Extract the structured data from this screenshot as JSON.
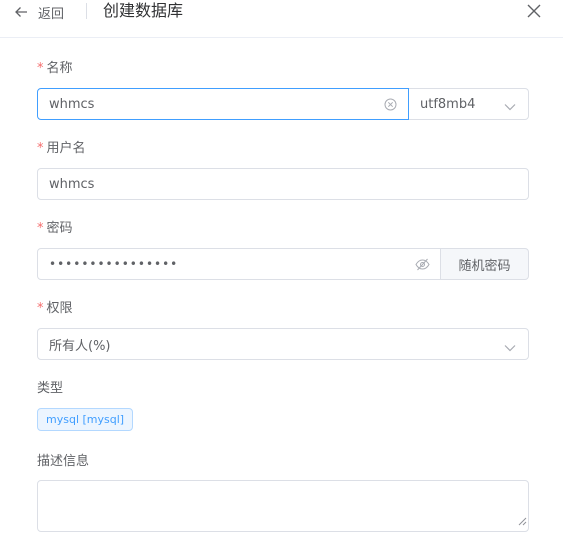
{
  "header": {
    "back_label": "返回",
    "title": "创建数据库"
  },
  "form": {
    "name": {
      "required": "*",
      "label": "名称",
      "value": "whmcs",
      "charset_value": "utf8mb4"
    },
    "username": {
      "required": "*",
      "label": "用户名",
      "value": "whmcs"
    },
    "password": {
      "required": "*",
      "label": "密码",
      "value": "••••••••••••••••",
      "random_button": "随机密码"
    },
    "permission": {
      "required": "*",
      "label": "权限",
      "value": "所有人(%)"
    },
    "type": {
      "label": "类型",
      "tag": "mysql [mysql]"
    },
    "description": {
      "label": "描述信息",
      "value": ""
    }
  },
  "icons": [
    "arrow-left-icon",
    "close-icon",
    "circle-close-icon",
    "chevron-down-icon",
    "eye-off-icon",
    "resize-handle-icon"
  ],
  "colors": {
    "accent": "#409eff",
    "required": "#f56c6c",
    "border": "#dcdfe6",
    "tag_bg": "#ecf5ff"
  }
}
